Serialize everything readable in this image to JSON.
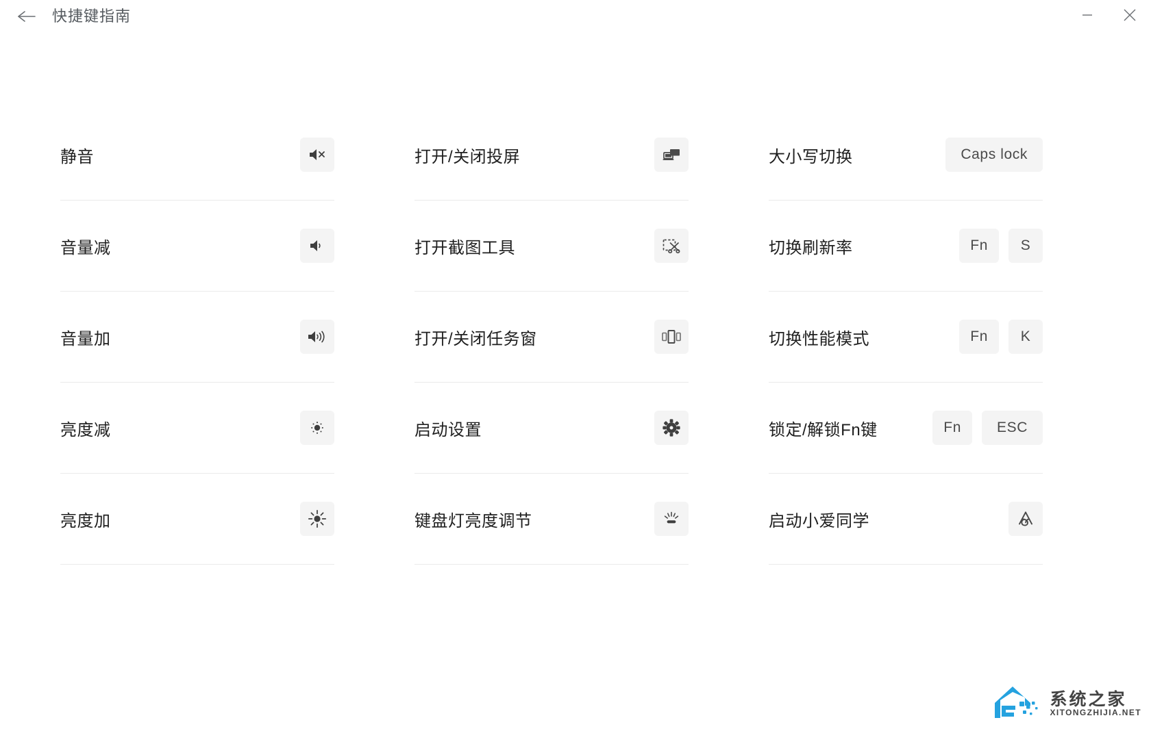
{
  "window": {
    "title": "快捷键指南",
    "back_icon": "back-arrow-icon",
    "minimize_icon": "minimize-icon",
    "close_icon": "close-icon"
  },
  "columns": [
    {
      "id": "column-1",
      "rows": [
        {
          "label": "静音",
          "action_type": "icon",
          "icon": "volume-mute-icon",
          "keys": []
        },
        {
          "label": "音量减",
          "action_type": "icon",
          "icon": "volume-down-icon",
          "keys": []
        },
        {
          "label": "音量加",
          "action_type": "icon",
          "icon": "volume-up-icon",
          "keys": []
        },
        {
          "label": "亮度减",
          "action_type": "icon",
          "icon": "brightness-low-icon",
          "keys": []
        },
        {
          "label": "亮度加",
          "action_type": "icon",
          "icon": "brightness-high-icon",
          "keys": []
        }
      ]
    },
    {
      "id": "column-2",
      "rows": [
        {
          "label": "打开/关闭投屏",
          "action_type": "icon",
          "icon": "screen-cast-icon",
          "keys": []
        },
        {
          "label": "打开截图工具",
          "action_type": "icon",
          "icon": "screenshot-tool-icon",
          "keys": []
        },
        {
          "label": "打开/关闭任务窗",
          "action_type": "icon",
          "icon": "task-view-icon",
          "keys": []
        },
        {
          "label": "启动设置",
          "action_type": "icon",
          "icon": "settings-gear-icon",
          "keys": []
        },
        {
          "label": "键盘灯亮度调节",
          "action_type": "icon",
          "icon": "keyboard-backlight-icon",
          "keys": []
        }
      ]
    },
    {
      "id": "column-3",
      "rows": [
        {
          "label": "大小写切换",
          "action_type": "keys",
          "icon": "",
          "keys": [
            "Caps lock"
          ]
        },
        {
          "label": "切换刷新率",
          "action_type": "keys",
          "icon": "",
          "keys": [
            "Fn",
            "S"
          ]
        },
        {
          "label": "切换性能模式",
          "action_type": "keys",
          "icon": "",
          "keys": [
            "Fn",
            "K"
          ]
        },
        {
          "label": "锁定/解锁Fn键",
          "action_type": "keys",
          "icon": "",
          "keys": [
            "Fn",
            "ESC"
          ]
        },
        {
          "label": "启动小爱同学",
          "action_type": "icon",
          "icon": "xiaoai-assistant-icon",
          "keys": []
        }
      ]
    }
  ],
  "watermark": {
    "cn": "系统之家",
    "en": "XITONGZHIJIA.NET",
    "logo_icon": "house-logo-icon"
  },
  "colors": {
    "chip_bg": "#f4f4f4",
    "divider": "#eaeaea",
    "text": "#1f1f1f",
    "title_text": "#555a5f",
    "icon": "#4a4a4a",
    "watermark_blue": "#1a9ede"
  }
}
